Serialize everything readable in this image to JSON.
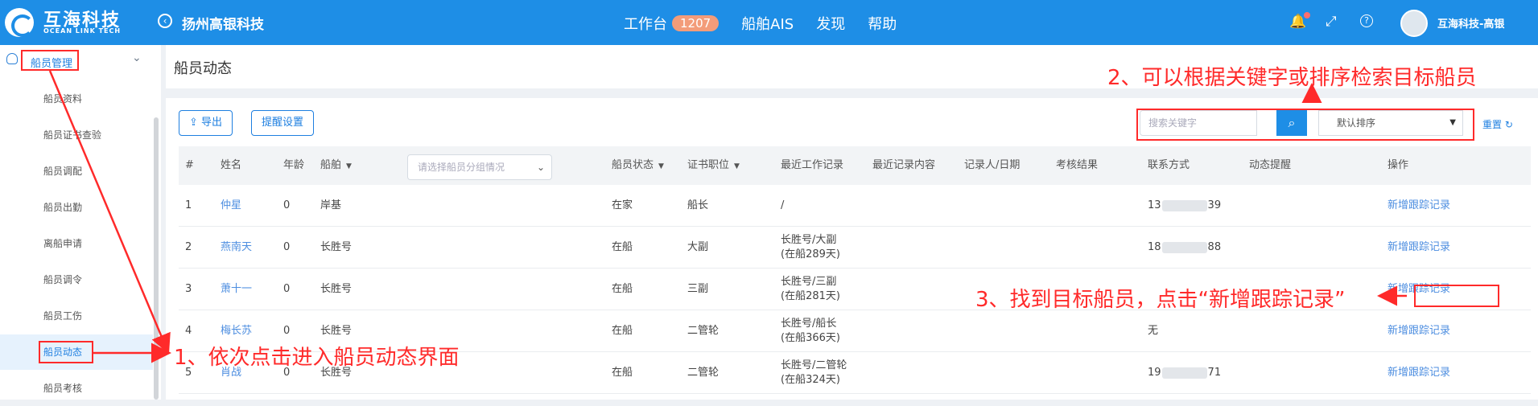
{
  "topbar": {
    "brand_cn": "互海科技",
    "brand_en": "OCEAN LINK TECH",
    "company": "扬州高银科技",
    "nav": [
      {
        "label": "工作台",
        "badge": "1207"
      },
      {
        "label": "船舶AIS"
      },
      {
        "label": "发现"
      },
      {
        "label": "帮助"
      }
    ],
    "user": "互海科技-高银",
    "back_glyph": "‹",
    "bell_glyph": "🔔",
    "expand_glyph": "⤢",
    "help_glyph": "?"
  },
  "sidebar": {
    "group_label": "船员管理",
    "chevron_glyph": "⌄",
    "items": [
      "船员资料",
      "船员证书查验",
      "船员调配",
      "船员出勤",
      "离船申请",
      "船员调令",
      "船员工伤",
      "船员动态",
      "船员考核"
    ]
  },
  "main": {
    "title": "船员动态",
    "export_label": "导出",
    "export_icon": "⇪",
    "remind_label": "提醒设置",
    "search_placeholder": "搜索关键字",
    "search_icon": "⌕",
    "sort_value": "默认排序",
    "sort_arrow": "▼",
    "reset_label": "重置",
    "reset_icon": "↻",
    "group_placeholder": "请选择船员分组情况",
    "group_chevron": "⌄",
    "caret": "▼"
  },
  "table": {
    "headers": {
      "idx": "#",
      "name": "姓名",
      "age": "年龄",
      "ship": "船舶",
      "status": "船员状态",
      "position": "证书职位",
      "work": "最近工作记录",
      "content": "最近记录内容",
      "recorder": "记录人/日期",
      "result": "考核结果",
      "contact": "联系方式",
      "reminder": "动态提醒",
      "ops": "操作"
    },
    "rows": [
      {
        "idx": "1",
        "name": "仲星",
        "age": "0",
        "ship": "岸基",
        "status": "在家",
        "position": "船长",
        "work1": "/",
        "work2": "",
        "contact_a": "13",
        "contact_b": "39",
        "op": "新增跟踪记录"
      },
      {
        "idx": "2",
        "name": "燕南天",
        "age": "0",
        "ship": "长胜号",
        "status": "在船",
        "position": "大副",
        "work1": "长胜号/大副",
        "work2": "(在船289天)",
        "contact_a": "18",
        "contact_b": "88",
        "op": "新增跟踪记录"
      },
      {
        "idx": "3",
        "name": "萧十一",
        "age": "0",
        "ship": "长胜号",
        "status": "在船",
        "position": "三副",
        "work1": "长胜号/三副",
        "work2": "(在船281天)",
        "contact_a": "",
        "contact_b": "",
        "op": "新增跟踪记录"
      },
      {
        "idx": "4",
        "name": "梅长苏",
        "age": "0",
        "ship": "长胜号",
        "status": "在船",
        "position": "二管轮",
        "work1": "长胜号/船长",
        "work2": "(在船366天)",
        "contact_a": "无",
        "contact_b": "",
        "op": "新增跟踪记录"
      },
      {
        "idx": "5",
        "name": "肖战",
        "age": "0",
        "ship": "长胜号",
        "status": "在船",
        "position": "二管轮",
        "work1": "长胜号/二管轮",
        "work2": "(在船324天)",
        "contact_a": "19",
        "contact_b": "71",
        "op": "新增跟踪记录"
      }
    ]
  },
  "annotations": {
    "step1": "1、依次点击进入船员动态界面",
    "step2": "2、可以根据关键字或排序检索目标船员",
    "step3": "3、找到目标船员，点击“新增跟踪记录”",
    "color": "#ff2a2a"
  }
}
